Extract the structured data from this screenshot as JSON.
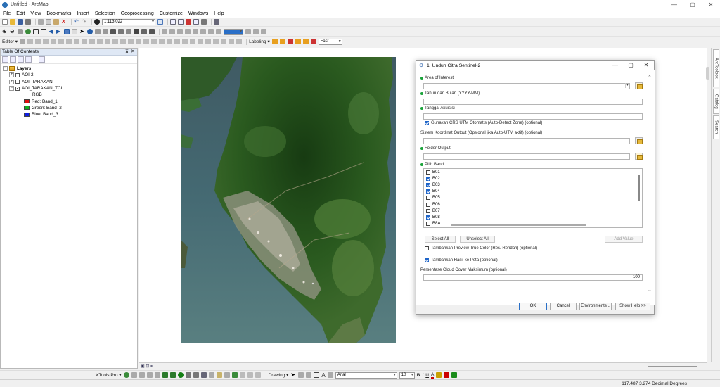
{
  "window": {
    "title": "Untitled - ArcMap",
    "controls": [
      "—",
      "▢",
      "✕"
    ]
  },
  "menu": [
    "File",
    "Edit",
    "View",
    "Bookmarks",
    "Insert",
    "Selection",
    "Geoprocessing",
    "Customize",
    "Windows",
    "Help"
  ],
  "toolbar": {
    "scale": "1:113.022",
    "editor_label": "Editor ▾",
    "labeling_label": "Labeling ▾",
    "render_mode": "Fast"
  },
  "toc": {
    "title": "Table Of Contents",
    "pin": "⊼",
    "close": "✕",
    "layers_label": "Layers",
    "items": [
      {
        "label": "AOI-2",
        "expand": "+",
        "checked": false
      },
      {
        "label": "AOI_TARAKAN",
        "expand": "+",
        "checked": false
      },
      {
        "label": "AOI_TARAKAN_TCI",
        "expand": "−",
        "checked": true
      }
    ],
    "rgb_label": "RGB",
    "bands": [
      {
        "label": "Red:   Band_1",
        "color": "#e01010"
      },
      {
        "label": "Green: Band_2",
        "color": "#10b020"
      },
      {
        "label": "Blue:  Band_3",
        "color": "#1020e0"
      }
    ]
  },
  "map_view": {
    "view_buttons": "▣ ⊡ ⏸"
  },
  "right_tabs": [
    "ArcToolbox",
    "Catalog",
    "Search"
  ],
  "dialog": {
    "title": "1. Unduh Citra Sentinel-2",
    "controls": [
      "—",
      "▢",
      "✕"
    ],
    "fields": {
      "aoi_label": "Area of Interest",
      "aoi_value": "",
      "month_label": "Tahun dan Bulan (YYYY-MM)",
      "month_value": "",
      "date_label": "Tanggal Akuisisi",
      "date_value": "",
      "utm_label": "Gunakan CRS UTM Otomatis (Auto-Detect Zone) (optional)",
      "utm_checked": true,
      "crs_label": "Sistem Koordinat Output (Opsional jika Auto-UTM aktif) (optional)",
      "crs_value": "",
      "folder_label": "Folder Output",
      "folder_value": "",
      "band_label": "Pilih Band",
      "bands": [
        {
          "name": "B01",
          "checked": false
        },
        {
          "name": "B02",
          "checked": true
        },
        {
          "name": "B03",
          "checked": true
        },
        {
          "name": "B04",
          "checked": true
        },
        {
          "name": "B05",
          "checked": false
        },
        {
          "name": "B06",
          "checked": false
        },
        {
          "name": "B07",
          "checked": false
        },
        {
          "name": "B08",
          "checked": true
        },
        {
          "name": "B8A",
          "checked": false
        }
      ],
      "select_all": "Select All",
      "unselect_all": "Unselect All",
      "add_value": "Add Value",
      "preview_label": "Tambahkan Preview True Color (Res. Rendah) (optional)",
      "preview_checked": false,
      "addmap_label": "Tambahkan Hasil ke Peta (optional)",
      "addmap_checked": true,
      "cloud_label": "Persentase Cloud Cover Maksimum (optional)",
      "cloud_value": "100"
    },
    "buttons": {
      "ok": "OK",
      "cancel": "Cancel",
      "environments": "Environments...",
      "help": "Show Help >>"
    }
  },
  "bottom_toolbar": {
    "xtools": "XTools Pro ▾",
    "drawing": "Drawing ▾",
    "font": "Arial",
    "size": "10",
    "bold": "B",
    "italic": "I",
    "underline": "U",
    "font_color": "A"
  },
  "status": {
    "coords": "117.487  3.274 Decimal Degrees"
  }
}
